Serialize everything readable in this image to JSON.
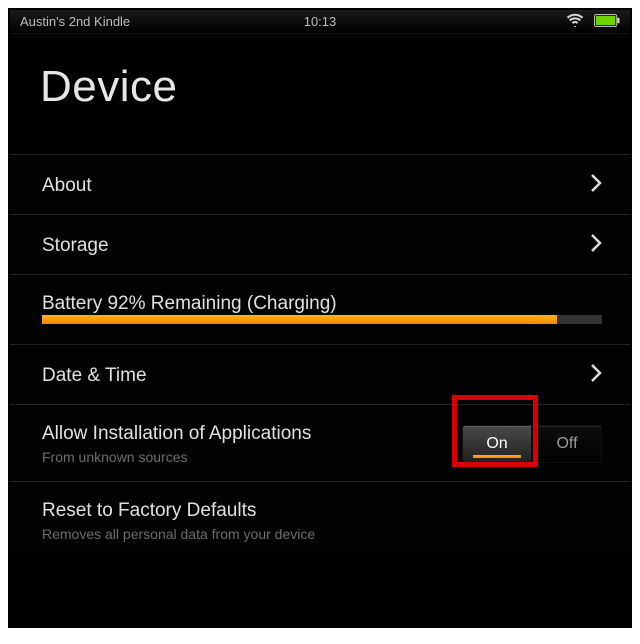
{
  "status_bar": {
    "device_name": "Austin's 2nd Kindle",
    "clock": "10:13"
  },
  "page": {
    "title": "Device"
  },
  "rows": {
    "about": {
      "label": "About"
    },
    "storage": {
      "label": "Storage"
    },
    "battery": {
      "label": "Battery 92% Remaining (Charging)",
      "percent": 92
    },
    "date_time": {
      "label": "Date & Time"
    },
    "allow_install": {
      "label": "Allow Installation of Applications",
      "sub": "From unknown sources",
      "on": "On",
      "off": "Off",
      "state": "on"
    },
    "reset": {
      "label": "Reset to Factory Defaults",
      "sub": "Removes all personal data from your device"
    }
  }
}
